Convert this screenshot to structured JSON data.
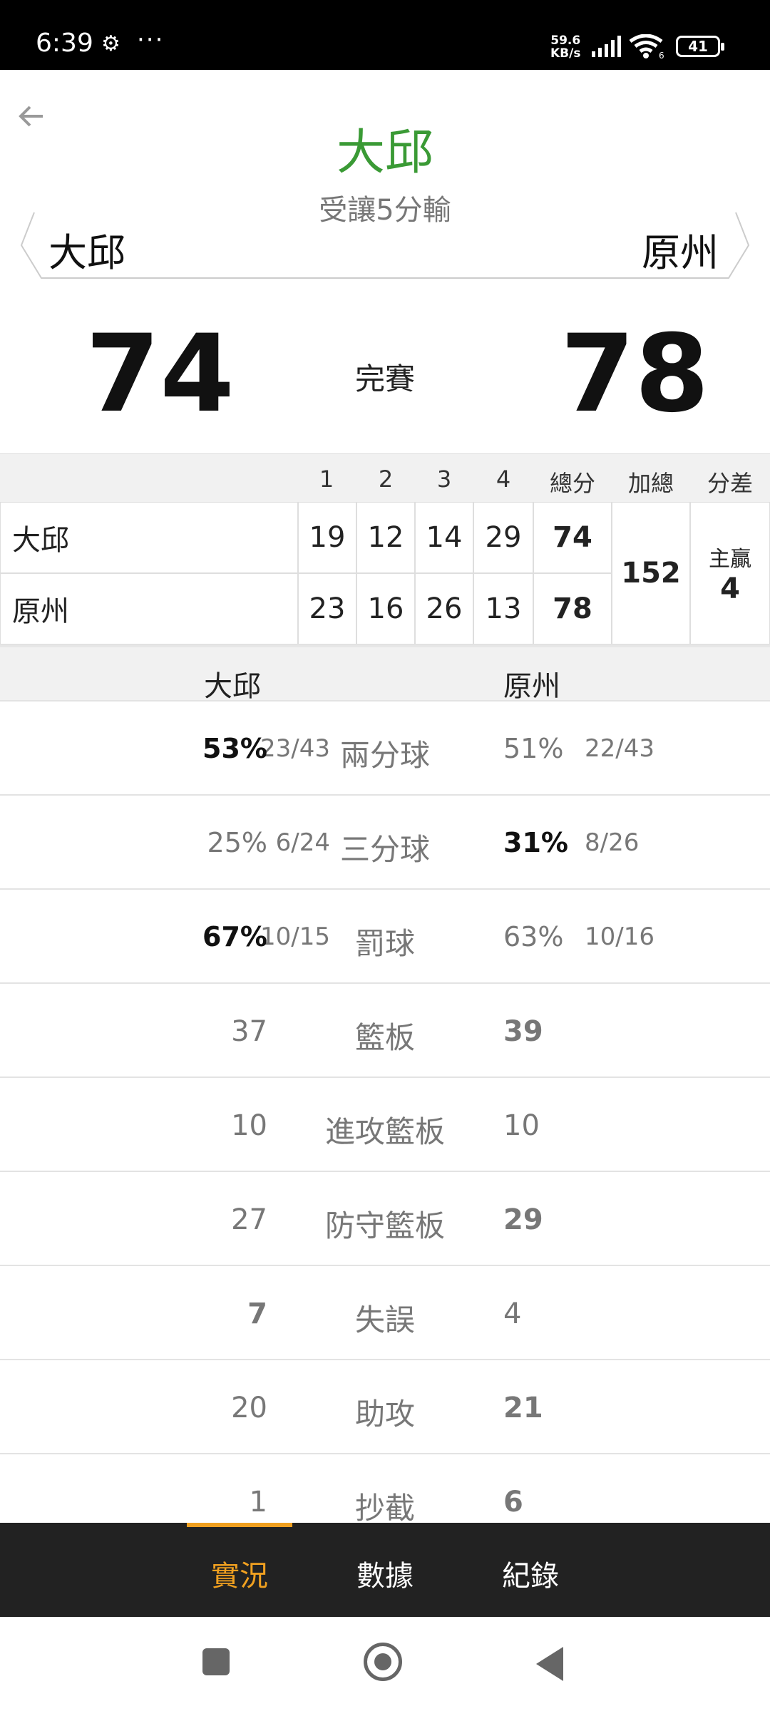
{
  "status_bar": {
    "time": "6:39",
    "net_speed_value": "59.6",
    "net_speed_unit": "KB/s",
    "wifi_label": "6",
    "battery": "41"
  },
  "header": {
    "title": "大邱",
    "handicap": "受讓5分輸",
    "home_team": "大邱",
    "away_team": "原州"
  },
  "score": {
    "home": "74",
    "away": "78",
    "status": "完賽"
  },
  "quarter_table": {
    "headers": [
      "1",
      "2",
      "3",
      "4",
      "總分",
      "加總",
      "分差"
    ],
    "rows": [
      {
        "team": "大邱",
        "q": [
          "19",
          "12",
          "14",
          "29"
        ],
        "total": "74"
      },
      {
        "team": "原州",
        "q": [
          "23",
          "16",
          "26",
          "13"
        ],
        "total": "78"
      }
    ],
    "combined": "152",
    "diff_label": "主贏",
    "diff_value": "4"
  },
  "stats": {
    "home_team": "大邱",
    "away_team": "原州",
    "rows": [
      {
        "label": "兩分球",
        "home_frac": "23/43",
        "home": "53%",
        "away": "51%",
        "away_frac": "22/43"
      },
      {
        "label": "三分球",
        "home_frac": "6/24",
        "home": "25%",
        "away": "31%",
        "away_frac": "8/26"
      },
      {
        "label": "罰球",
        "home_frac": "10/15",
        "home": "67%",
        "away": "63%",
        "away_frac": "10/16"
      },
      {
        "label": "籃板",
        "home": "37",
        "away": "39"
      },
      {
        "label": "進攻籃板",
        "home": "10",
        "away": "10"
      },
      {
        "label": "防守籃板",
        "home": "27",
        "away": "29"
      },
      {
        "label": "失誤",
        "home": "7",
        "away": "4"
      },
      {
        "label": "助攻",
        "home": "20",
        "away": "21"
      },
      {
        "label": "抄截",
        "home": "1",
        "away": "6"
      }
    ]
  },
  "tabs": [
    {
      "label": "實況",
      "active": true
    },
    {
      "label": "數據",
      "active": false
    },
    {
      "label": "紀錄",
      "active": false
    }
  ],
  "colors": {
    "title_green": "#3a9a35",
    "accent_orange": "#f0a020",
    "tabbar_bg": "#222222"
  }
}
